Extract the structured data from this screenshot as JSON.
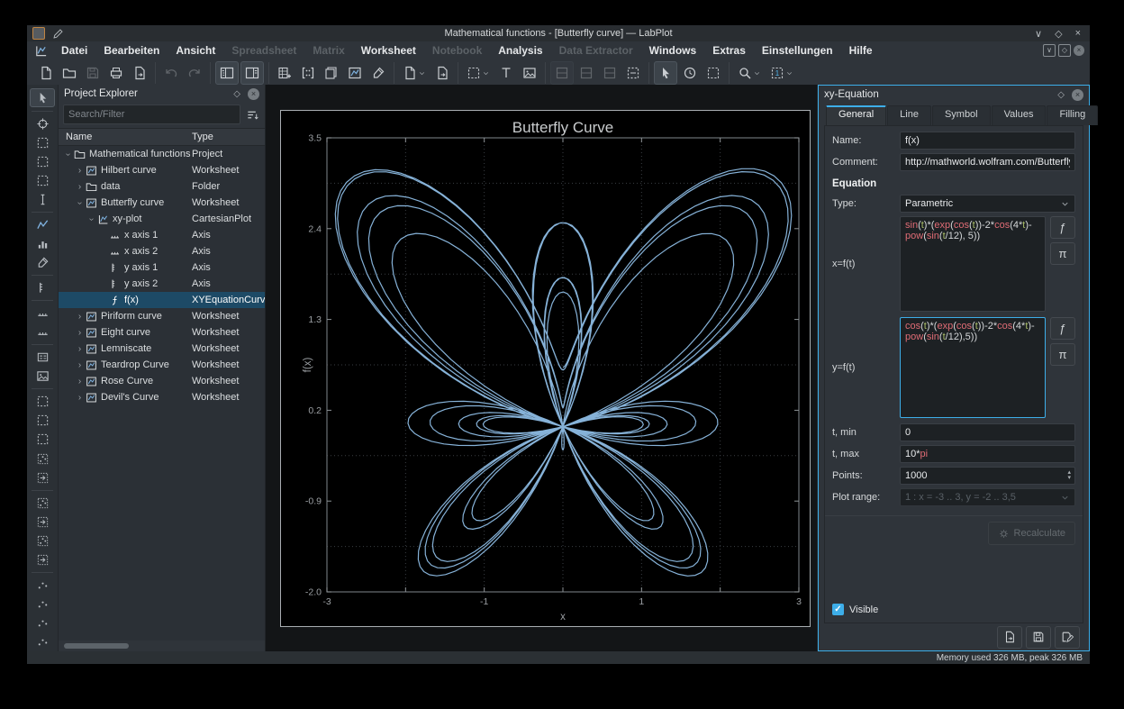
{
  "window": {
    "title": "Mathematical functions - [Butterfly curve] — LabPlot",
    "controls": [
      "minimize",
      "maximize",
      "close"
    ]
  },
  "menubar": {
    "items": [
      {
        "label": "Datei",
        "enabled": true
      },
      {
        "label": "Bearbeiten",
        "enabled": true
      },
      {
        "label": "Ansicht",
        "enabled": true
      },
      {
        "label": "Spreadsheet",
        "enabled": false
      },
      {
        "label": "Matrix",
        "enabled": false
      },
      {
        "label": "Worksheet",
        "enabled": true
      },
      {
        "label": "Notebook",
        "enabled": false
      },
      {
        "label": "Analysis",
        "enabled": true
      },
      {
        "label": "Data Extractor",
        "enabled": false
      },
      {
        "label": "Windows",
        "enabled": true
      },
      {
        "label": "Extras",
        "enabled": true
      },
      {
        "label": "Einstellungen",
        "enabled": true
      },
      {
        "label": "Hilfe",
        "enabled": true
      }
    ]
  },
  "toolbar": {
    "groups": [
      {
        "items": [
          {
            "name": "new-project",
            "icon": "doc-new"
          },
          {
            "name": "open-project",
            "icon": "doc-open"
          },
          {
            "name": "save-project",
            "icon": "floppy",
            "disabled": true
          },
          {
            "name": "print",
            "icon": "printer"
          },
          {
            "name": "export",
            "icon": "doc-export"
          }
        ]
      },
      {
        "items": [
          {
            "name": "undo",
            "icon": "undo",
            "disabled": true
          },
          {
            "name": "redo",
            "icon": "redo",
            "disabled": true
          }
        ]
      },
      {
        "items": [
          {
            "name": "toggle-project-explorer",
            "icon": "panel-tree",
            "active": true
          },
          {
            "name": "toggle-properties-explorer",
            "icon": "panel-props",
            "active": true
          }
        ]
      },
      {
        "items": [
          {
            "name": "new-spreadsheet",
            "icon": "spreadsheet"
          },
          {
            "name": "new-matrix",
            "icon": "matrix"
          },
          {
            "name": "new-workbook",
            "icon": "workbook"
          },
          {
            "name": "new-worksheet",
            "icon": "worksheet"
          },
          {
            "name": "new-datapicker",
            "icon": "dropper"
          }
        ]
      },
      {
        "items": [
          {
            "name": "new-live-data-source",
            "icon": "doc-new",
            "chevron": true
          },
          {
            "name": "new-notebook",
            "icon": "doc-export"
          }
        ]
      },
      {
        "items": [
          {
            "name": "zoom-fit-worksheet",
            "icon": "dashed-box",
            "chevron": true
          },
          {
            "name": "add-text-label",
            "icon": "text"
          },
          {
            "name": "add-image",
            "icon": "image"
          }
        ]
      },
      {
        "items": [
          {
            "name": "vertical-layout",
            "icon": "layout",
            "disabled": true,
            "active": true
          },
          {
            "name": "horizontal-layout",
            "icon": "layout",
            "disabled": true
          },
          {
            "name": "grid-layout",
            "icon": "layout",
            "disabled": true
          },
          {
            "name": "break-layout",
            "icon": "layout-break"
          }
        ]
      },
      {
        "items": [
          {
            "name": "select-and-edit",
            "icon": "cursor",
            "active": true
          },
          {
            "name": "navigate",
            "icon": "clock"
          },
          {
            "name": "select-and-zoom",
            "icon": "dashed-box"
          }
        ]
      },
      {
        "items": [
          {
            "name": "magnification",
            "icon": "magnifier",
            "chevron": true
          },
          {
            "name": "zoom-preset",
            "icon": "zoom-one",
            "chevron": true
          }
        ]
      }
    ]
  },
  "left_toolbar": {
    "groups": [
      {
        "items": [
          {
            "name": "select-and-edit",
            "icon": "cursor",
            "active": true
          }
        ]
      },
      {
        "items": [
          {
            "name": "crosshair",
            "icon": "crosshair"
          },
          {
            "name": "select-region-zoom",
            "icon": "dashed-box"
          },
          {
            "name": "select-x-region-zoom",
            "icon": "dashed-box"
          },
          {
            "name": "select-y-region-zoom",
            "icon": "dashed-box"
          },
          {
            "name": "cursor-line",
            "icon": "ibeam"
          }
        ]
      },
      {
        "items": [
          {
            "name": "add-xy-curve",
            "icon": "chart"
          },
          {
            "name": "add-histogram",
            "icon": "bars"
          },
          {
            "name": "add-fit-curve",
            "icon": "dropper"
          }
        ]
      },
      {
        "items": [
          {
            "name": "add-vertical-axis",
            "icon": "axis-v"
          }
        ]
      },
      {
        "items": [
          {
            "name": "add-horizontal-axis",
            "icon": "axis-h"
          },
          {
            "name": "add-axes",
            "icon": "axis-h"
          }
        ]
      },
      {
        "items": [
          {
            "name": "add-legend",
            "icon": "legend"
          },
          {
            "name": "add-plot-image",
            "icon": "image"
          }
        ]
      },
      {
        "items": [
          {
            "name": "zoom-in-region",
            "icon": "dashed-box"
          },
          {
            "name": "zoom-out-region",
            "icon": "dashed-box"
          },
          {
            "name": "zoom-fit-page",
            "icon": "dashed-box"
          },
          {
            "name": "fit-selection",
            "icon": "grid-dots"
          },
          {
            "name": "scale-auto",
            "icon": "box-arrow"
          }
        ]
      },
      {
        "items": [
          {
            "name": "scale-auto-x",
            "icon": "grid-dots"
          },
          {
            "name": "shift-x",
            "icon": "box-arrow"
          },
          {
            "name": "scale-auto-y",
            "icon": "grid-dots"
          },
          {
            "name": "shift-y",
            "icon": "box-arrow"
          }
        ]
      },
      {
        "items": [
          {
            "name": "zoom-in-x",
            "icon": "dots"
          },
          {
            "name": "zoom-out-x",
            "icon": "dots"
          },
          {
            "name": "zoom-in-y",
            "icon": "dots"
          },
          {
            "name": "zoom-out-y",
            "icon": "dots"
          }
        ]
      }
    ]
  },
  "project_explorer": {
    "title": "Project Explorer",
    "search_placeholder": "Search/Filter",
    "columns": [
      "Name",
      "Type"
    ],
    "rows": [
      {
        "name": "Mathematical functions",
        "type": "Project",
        "depth": 0,
        "expander": "open",
        "icon": "folder"
      },
      {
        "name": "Hilbert curve",
        "type": "Worksheet",
        "depth": 1,
        "expander": "closed",
        "icon": "worksheet"
      },
      {
        "name": "data",
        "type": "Folder",
        "depth": 1,
        "expander": "closed",
        "icon": "folder"
      },
      {
        "name": "Butterfly curve",
        "type": "Worksheet",
        "depth": 1,
        "expander": "open",
        "icon": "worksheet"
      },
      {
        "name": "xy-plot",
        "type": "CartesianPlot",
        "depth": 2,
        "expander": "open",
        "icon": "plot"
      },
      {
        "name": "x axis 1",
        "type": "Axis",
        "depth": 3,
        "expander": "none",
        "icon": "axis-h"
      },
      {
        "name": "x axis 2",
        "type": "Axis",
        "depth": 3,
        "expander": "none",
        "icon": "axis-h"
      },
      {
        "name": "y axis 1",
        "type": "Axis",
        "depth": 3,
        "expander": "none",
        "icon": "axis-v"
      },
      {
        "name": "y axis 2",
        "type": "Axis",
        "depth": 3,
        "expander": "none",
        "icon": "axis-v"
      },
      {
        "name": "f(x)",
        "type": "XYEquationCurve",
        "depth": 3,
        "expander": "none",
        "icon": "fx",
        "selected": true
      },
      {
        "name": "Piriform curve",
        "type": "Worksheet",
        "depth": 1,
        "expander": "closed",
        "icon": "worksheet"
      },
      {
        "name": "Eight curve",
        "type": "Worksheet",
        "depth": 1,
        "expander": "closed",
        "icon": "worksheet"
      },
      {
        "name": "Lemniscate",
        "type": "Worksheet",
        "depth": 1,
        "expander": "closed",
        "icon": "worksheet"
      },
      {
        "name": "Teardrop Curve",
        "type": "Worksheet",
        "depth": 1,
        "expander": "closed",
        "icon": "worksheet"
      },
      {
        "name": "Rose Curve",
        "type": "Worksheet",
        "depth": 1,
        "expander": "closed",
        "icon": "worksheet"
      },
      {
        "name": "Devil's Curve",
        "type": "Worksheet",
        "depth": 1,
        "expander": "closed",
        "icon": "worksheet"
      }
    ]
  },
  "chart_data": {
    "type": "line",
    "title": "Butterfly Curve",
    "xlabel": "x",
    "ylabel": "f(x)",
    "xlim": [
      -3,
      3
    ],
    "ylim": [
      -2.0,
      3.5
    ],
    "x_ticks": [
      -3,
      -2,
      -1,
      0,
      1,
      2,
      3
    ],
    "x_tick_labels": [
      "-3",
      "",
      "-1",
      "",
      "1",
      "",
      "3"
    ],
    "y_ticks": [
      3.5,
      2.4,
      1.3,
      0.2,
      -0.9,
      -2.0
    ],
    "y_tick_labels": [
      "3.5",
      "2.4",
      "1.3",
      "0.2",
      "-0.9",
      "-2.0"
    ],
    "grid": "minor-dotted",
    "legend": "none",
    "line_color": "#86b2d8",
    "parametric": {
      "x_expr": "sin(t)*(exp(cos(t))-2*cos(4*t)-pow(sin(t/12), 5))",
      "y_expr": "cos(t)*(exp(cos(t))-2*cos(4*t)-pow(sin(t/12),5))",
      "t_min": 0,
      "t_max": "10*pi",
      "points": 1000
    }
  },
  "properties": {
    "title": "xy-Equation",
    "tabs": [
      {
        "label": "General",
        "active": true
      },
      {
        "label": "Line",
        "active": false
      },
      {
        "label": "Symbol",
        "active": false
      },
      {
        "label": "Values",
        "active": false
      },
      {
        "label": "Filling",
        "active": false
      }
    ],
    "fields": {
      "name_label": "Name:",
      "name_value": "f(x)",
      "comment_label": "Comment:",
      "comment_value": "http://mathworld.wolfram.com/ButterflyCurve.html",
      "section_equation": "Equation",
      "type_label": "Type:",
      "type_value": "Parametric",
      "x_label": "x=f(t)",
      "x_formula": "sin(t)*(exp(cos(t))-2*cos(4*t)-pow(sin(t/12), 5))",
      "y_label": "y=f(t)",
      "y_formula": "cos(t)*(exp(cos(t))-2*cos(4*t)-pow(sin(t/12),5))",
      "tmin_label": "t, min",
      "tmin_value": "0",
      "tmax_label": "t, max",
      "tmax_value": "10*pi",
      "points_label": "Points:",
      "points_value": "1000",
      "plot_range_label": "Plot range:",
      "plot_range_value": "1 : x = -3 .. 3, y = -2 .. 3,5",
      "recalculate_label": "Recalculate",
      "visible_label": "Visible"
    }
  },
  "statusbar": {
    "memory": "Memory used 326 MB, peak 326 MB"
  },
  "colors": {
    "accent": "#3daee9",
    "curve": "#86b2d8",
    "function_token": "#e06c75",
    "variable_token": "#a9bd68",
    "selection": "#1d4a66"
  }
}
